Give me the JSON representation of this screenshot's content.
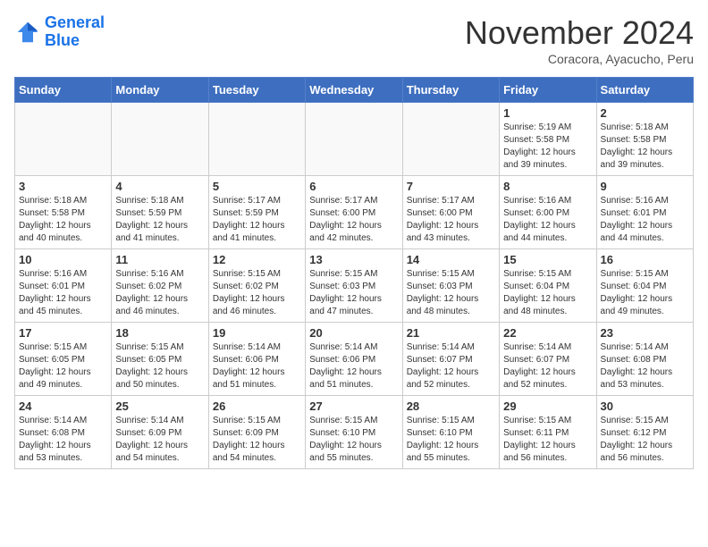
{
  "header": {
    "logo_line1": "General",
    "logo_line2": "Blue",
    "month_title": "November 2024",
    "subtitle": "Coracora, Ayacucho, Peru"
  },
  "days_of_week": [
    "Sunday",
    "Monday",
    "Tuesday",
    "Wednesday",
    "Thursday",
    "Friday",
    "Saturday"
  ],
  "weeks": [
    [
      {
        "day": "",
        "info": ""
      },
      {
        "day": "",
        "info": ""
      },
      {
        "day": "",
        "info": ""
      },
      {
        "day": "",
        "info": ""
      },
      {
        "day": "",
        "info": ""
      },
      {
        "day": "1",
        "info": "Sunrise: 5:19 AM\nSunset: 5:58 PM\nDaylight: 12 hours\nand 39 minutes."
      },
      {
        "day": "2",
        "info": "Sunrise: 5:18 AM\nSunset: 5:58 PM\nDaylight: 12 hours\nand 39 minutes."
      }
    ],
    [
      {
        "day": "3",
        "info": "Sunrise: 5:18 AM\nSunset: 5:58 PM\nDaylight: 12 hours\nand 40 minutes."
      },
      {
        "day": "4",
        "info": "Sunrise: 5:18 AM\nSunset: 5:59 PM\nDaylight: 12 hours\nand 41 minutes."
      },
      {
        "day": "5",
        "info": "Sunrise: 5:17 AM\nSunset: 5:59 PM\nDaylight: 12 hours\nand 41 minutes."
      },
      {
        "day": "6",
        "info": "Sunrise: 5:17 AM\nSunset: 6:00 PM\nDaylight: 12 hours\nand 42 minutes."
      },
      {
        "day": "7",
        "info": "Sunrise: 5:17 AM\nSunset: 6:00 PM\nDaylight: 12 hours\nand 43 minutes."
      },
      {
        "day": "8",
        "info": "Sunrise: 5:16 AM\nSunset: 6:00 PM\nDaylight: 12 hours\nand 44 minutes."
      },
      {
        "day": "9",
        "info": "Sunrise: 5:16 AM\nSunset: 6:01 PM\nDaylight: 12 hours\nand 44 minutes."
      }
    ],
    [
      {
        "day": "10",
        "info": "Sunrise: 5:16 AM\nSunset: 6:01 PM\nDaylight: 12 hours\nand 45 minutes."
      },
      {
        "day": "11",
        "info": "Sunrise: 5:16 AM\nSunset: 6:02 PM\nDaylight: 12 hours\nand 46 minutes."
      },
      {
        "day": "12",
        "info": "Sunrise: 5:15 AM\nSunset: 6:02 PM\nDaylight: 12 hours\nand 46 minutes."
      },
      {
        "day": "13",
        "info": "Sunrise: 5:15 AM\nSunset: 6:03 PM\nDaylight: 12 hours\nand 47 minutes."
      },
      {
        "day": "14",
        "info": "Sunrise: 5:15 AM\nSunset: 6:03 PM\nDaylight: 12 hours\nand 48 minutes."
      },
      {
        "day": "15",
        "info": "Sunrise: 5:15 AM\nSunset: 6:04 PM\nDaylight: 12 hours\nand 48 minutes."
      },
      {
        "day": "16",
        "info": "Sunrise: 5:15 AM\nSunset: 6:04 PM\nDaylight: 12 hours\nand 49 minutes."
      }
    ],
    [
      {
        "day": "17",
        "info": "Sunrise: 5:15 AM\nSunset: 6:05 PM\nDaylight: 12 hours\nand 49 minutes."
      },
      {
        "day": "18",
        "info": "Sunrise: 5:15 AM\nSunset: 6:05 PM\nDaylight: 12 hours\nand 50 minutes."
      },
      {
        "day": "19",
        "info": "Sunrise: 5:14 AM\nSunset: 6:06 PM\nDaylight: 12 hours\nand 51 minutes."
      },
      {
        "day": "20",
        "info": "Sunrise: 5:14 AM\nSunset: 6:06 PM\nDaylight: 12 hours\nand 51 minutes."
      },
      {
        "day": "21",
        "info": "Sunrise: 5:14 AM\nSunset: 6:07 PM\nDaylight: 12 hours\nand 52 minutes."
      },
      {
        "day": "22",
        "info": "Sunrise: 5:14 AM\nSunset: 6:07 PM\nDaylight: 12 hours\nand 52 minutes."
      },
      {
        "day": "23",
        "info": "Sunrise: 5:14 AM\nSunset: 6:08 PM\nDaylight: 12 hours\nand 53 minutes."
      }
    ],
    [
      {
        "day": "24",
        "info": "Sunrise: 5:14 AM\nSunset: 6:08 PM\nDaylight: 12 hours\nand 53 minutes."
      },
      {
        "day": "25",
        "info": "Sunrise: 5:14 AM\nSunset: 6:09 PM\nDaylight: 12 hours\nand 54 minutes."
      },
      {
        "day": "26",
        "info": "Sunrise: 5:15 AM\nSunset: 6:09 PM\nDaylight: 12 hours\nand 54 minutes."
      },
      {
        "day": "27",
        "info": "Sunrise: 5:15 AM\nSunset: 6:10 PM\nDaylight: 12 hours\nand 55 minutes."
      },
      {
        "day": "28",
        "info": "Sunrise: 5:15 AM\nSunset: 6:10 PM\nDaylight: 12 hours\nand 55 minutes."
      },
      {
        "day": "29",
        "info": "Sunrise: 5:15 AM\nSunset: 6:11 PM\nDaylight: 12 hours\nand 56 minutes."
      },
      {
        "day": "30",
        "info": "Sunrise: 5:15 AM\nSunset: 6:12 PM\nDaylight: 12 hours\nand 56 minutes."
      }
    ]
  ]
}
